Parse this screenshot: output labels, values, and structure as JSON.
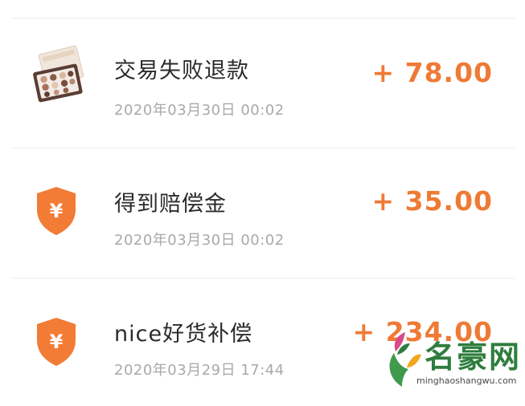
{
  "transactions": [
    {
      "title": "交易失败退款",
      "date": "2020年03月30日 00:02",
      "amount": "+ 78.00",
      "icon": "eyeshadow-palette-thumbnail"
    },
    {
      "title": "得到赔偿金",
      "date": "2020年03月30日 00:02",
      "amount": "+ 35.00",
      "icon": "yuan-shield-icon",
      "icon_glyph": "¥"
    },
    {
      "title": "nice好货补偿",
      "date": "2020年03月29日 17:44",
      "amount": "+ 234.00",
      "icon": "yuan-shield-icon",
      "icon_glyph": "¥"
    }
  ],
  "watermark": {
    "name": "名豪网",
    "url": "minghaoshangwu.com"
  },
  "colors": {
    "accent": "#ef7a35",
    "shield": "#f27b35",
    "title": "#2b2b2b",
    "date": "#a9a9a9",
    "divider": "#ececec"
  }
}
